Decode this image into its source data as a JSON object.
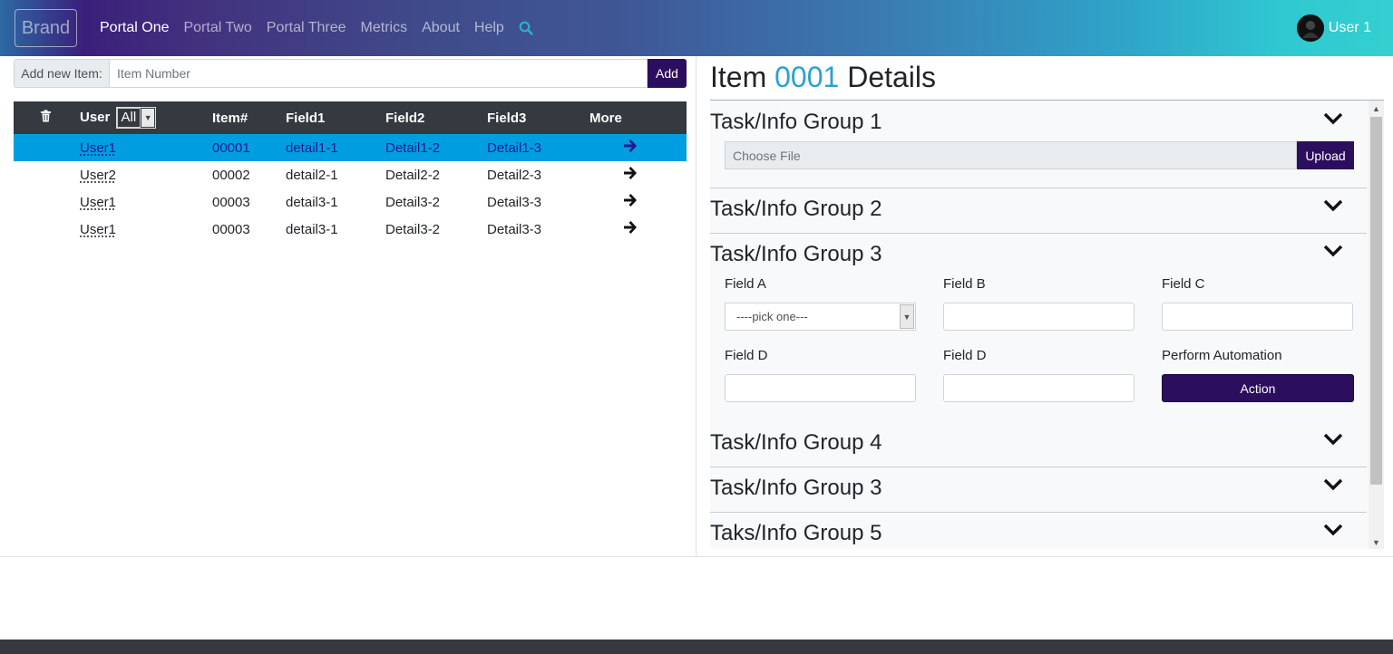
{
  "navbar": {
    "brand": "Brand",
    "links": [
      "Portal One",
      "Portal Two",
      "Portal Three",
      "Metrics",
      "About",
      "Help"
    ],
    "active_link": "Portal One",
    "search_icon": "search-icon",
    "user_name": "User 1",
    "gradient_colors": [
      "#3a1f7a",
      "#3f5796",
      "#34d0cf"
    ]
  },
  "add_item": {
    "label": "Add new Item:",
    "placeholder": "Item Number",
    "button": "Add"
  },
  "table": {
    "headers": {
      "delete_icon": "trash-icon",
      "user": "User",
      "user_filter": "All",
      "item": "Item#",
      "field1": "Field1",
      "field2": "Field2",
      "field3": "Field3",
      "more": "More"
    },
    "rows": [
      {
        "user": "User1",
        "item": "00001",
        "field1": "detail1-1",
        "field2": "Detail1-2",
        "field3": "Detail1-3",
        "selected": true
      },
      {
        "user": "User2",
        "item": "00002",
        "field1": "detail2-1",
        "field2": "Detail2-2",
        "field3": "Detail2-3",
        "selected": false
      },
      {
        "user": "User1",
        "item": "00003",
        "field1": "detail3-1",
        "field2": "Detail3-2",
        "field3": "Detail3-3",
        "selected": false
      },
      {
        "user": "User1",
        "item": "00003",
        "field1": "detail3-1",
        "field2": "Detail3-2",
        "field3": "Detail3-3",
        "selected": false
      }
    ],
    "selected_color": "#009ee0"
  },
  "details": {
    "title_prefix": "Item",
    "title_number": "0001",
    "title_suffix": "Details",
    "groups": [
      "Task/Info Group 1",
      "Task/Info Group 2",
      "Task/Info Group 3",
      "Task/Info Group 4",
      "Task/Info Group 3",
      "Taks/Info Group 5"
    ],
    "file_placeholder": "Choose File",
    "upload_button": "Upload",
    "fields": {
      "a_label": "Field A",
      "a_value": "----pick one---",
      "b_label": "Field B",
      "c_label": "Field C",
      "d1_label": "Field D",
      "d2_label": "Field D",
      "automation_label": "Perform Automation",
      "action_button": "Action"
    },
    "accent_color": "#2a9fd6",
    "button_color": "#2c0e5e"
  }
}
